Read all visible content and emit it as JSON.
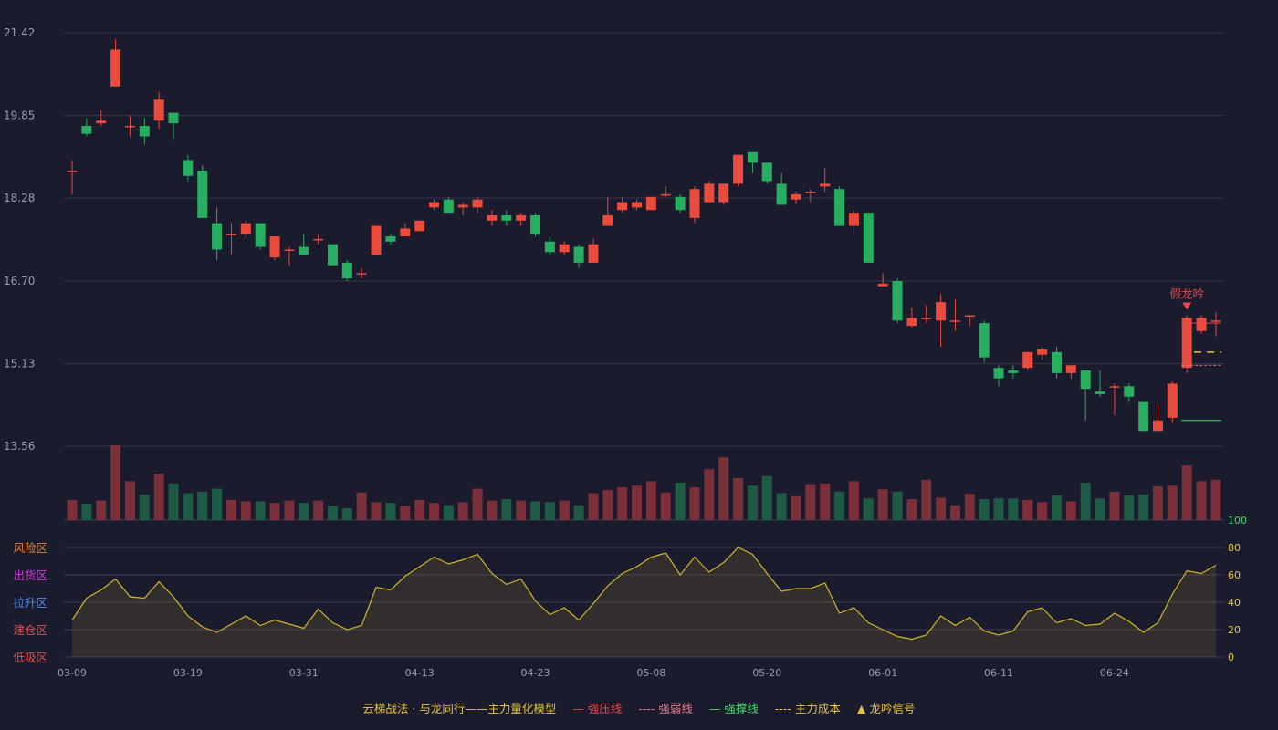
{
  "chart_data": {
    "type": "candlestick",
    "price_ticks": [
      "21.42",
      "19.85",
      "18.28",
      "16.70",
      "15.13",
      "13.56"
    ],
    "price_range": [
      13.56,
      21.42
    ],
    "x_ticks": [
      {
        "index": 0,
        "label": "03-09"
      },
      {
        "index": 8,
        "label": "03-19"
      },
      {
        "index": 16,
        "label": "03-31"
      },
      {
        "index": 24,
        "label": "04-13"
      },
      {
        "index": 32,
        "label": "04-23"
      },
      {
        "index": 40,
        "label": "05-08"
      },
      {
        "index": 48,
        "label": "05-20"
      },
      {
        "index": 56,
        "label": "06-01"
      },
      {
        "index": 64,
        "label": "06-11"
      },
      {
        "index": 72,
        "label": "06-24"
      }
    ],
    "candles": [
      [
        18.8,
        18.8,
        19.0,
        18.35
      ],
      [
        19.65,
        19.5,
        19.8,
        19.45
      ],
      [
        19.7,
        19.75,
        19.95,
        19.65
      ],
      [
        20.4,
        21.1,
        21.3,
        20.4
      ],
      [
        19.65,
        19.65,
        19.85,
        19.45
      ],
      [
        19.65,
        19.45,
        19.8,
        19.3
      ],
      [
        19.75,
        20.15,
        20.3,
        19.6
      ],
      [
        19.9,
        19.7,
        19.9,
        19.4
      ],
      [
        19.0,
        18.7,
        19.1,
        18.6
      ],
      [
        18.8,
        17.9,
        18.9,
        17.9
      ],
      [
        17.8,
        17.3,
        18.1,
        17.1
      ],
      [
        17.6,
        17.6,
        17.8,
        17.2
      ],
      [
        17.6,
        17.8,
        17.85,
        17.5
      ],
      [
        17.8,
        17.35,
        17.8,
        17.3
      ],
      [
        17.15,
        17.55,
        17.55,
        17.1
      ],
      [
        17.3,
        17.3,
        17.35,
        17.0
      ],
      [
        17.35,
        17.2,
        17.6,
        17.2
      ],
      [
        17.5,
        17.5,
        17.6,
        17.4
      ],
      [
        17.4,
        17.0,
        17.4,
        17.0
      ],
      [
        17.05,
        16.75,
        17.1,
        16.7
      ],
      [
        16.85,
        16.85,
        16.95,
        16.75
      ],
      [
        17.2,
        17.75,
        17.75,
        17.2
      ],
      [
        17.55,
        17.45,
        17.6,
        17.4
      ],
      [
        17.55,
        17.7,
        17.8,
        17.55
      ],
      [
        17.65,
        17.85,
        17.85,
        17.65
      ],
      [
        18.1,
        18.2,
        18.25,
        18.05
      ],
      [
        18.25,
        18.0,
        18.3,
        18.0
      ],
      [
        18.1,
        18.15,
        18.2,
        17.95
      ],
      [
        18.1,
        18.25,
        18.3,
        18.0
      ],
      [
        17.85,
        17.95,
        18.05,
        17.75
      ],
      [
        17.95,
        17.85,
        18.05,
        17.75
      ],
      [
        17.85,
        17.95,
        18.0,
        17.75
      ],
      [
        17.95,
        17.6,
        18.0,
        17.55
      ],
      [
        17.45,
        17.25,
        17.55,
        17.2
      ],
      [
        17.25,
        17.4,
        17.45,
        17.2
      ],
      [
        17.35,
        17.05,
        17.4,
        16.95
      ],
      [
        17.05,
        17.4,
        17.5,
        17.05
      ],
      [
        17.75,
        17.95,
        18.3,
        17.75
      ],
      [
        18.05,
        18.2,
        18.3,
        18.0
      ],
      [
        18.1,
        18.2,
        18.25,
        18.05
      ],
      [
        18.05,
        18.3,
        18.3,
        18.05
      ],
      [
        18.35,
        18.35,
        18.5,
        18.3
      ],
      [
        18.3,
        18.05,
        18.35,
        18.0
      ],
      [
        17.9,
        18.45,
        18.5,
        17.8
      ],
      [
        18.2,
        18.55,
        18.6,
        18.2
      ],
      [
        18.2,
        18.55,
        18.55,
        18.15
      ],
      [
        18.55,
        19.1,
        19.1,
        18.5
      ],
      [
        19.15,
        18.95,
        19.15,
        18.75
      ],
      [
        18.95,
        18.6,
        18.95,
        18.55
      ],
      [
        18.55,
        18.15,
        18.75,
        18.15
      ],
      [
        18.25,
        18.35,
        18.4,
        18.15
      ],
      [
        18.4,
        18.4,
        18.45,
        18.2
      ],
      [
        18.5,
        18.55,
        18.85,
        18.4
      ],
      [
        18.45,
        17.75,
        18.5,
        17.75
      ],
      [
        17.75,
        18.0,
        18.05,
        17.6
      ],
      [
        18.0,
        17.05,
        18.0,
        17.05
      ],
      [
        16.6,
        16.65,
        16.85,
        16.6
      ],
      [
        16.7,
        15.95,
        16.75,
        15.9
      ],
      [
        15.85,
        16.0,
        16.2,
        15.8
      ],
      [
        16.0,
        16.0,
        16.25,
        15.9
      ],
      [
        15.95,
        16.3,
        16.45,
        15.45
      ],
      [
        15.95,
        15.95,
        16.35,
        15.75
      ],
      [
        16.05,
        16.05,
        16.05,
        15.85
      ],
      [
        15.9,
        15.25,
        15.95,
        15.15
      ],
      [
        15.05,
        14.85,
        15.1,
        14.7
      ],
      [
        15.0,
        14.95,
        15.1,
        14.85
      ],
      [
        15.05,
        15.35,
        15.35,
        15.0
      ],
      [
        15.3,
        15.4,
        15.45,
        15.2
      ],
      [
        15.35,
        14.95,
        15.45,
        14.85
      ],
      [
        14.95,
        15.1,
        15.1,
        14.85
      ],
      [
        15.0,
        14.65,
        15.0,
        14.05
      ],
      [
        14.6,
        14.55,
        15.0,
        14.5
      ],
      [
        14.7,
        14.7,
        14.75,
        14.15
      ],
      [
        14.7,
        14.5,
        14.75,
        14.4
      ],
      [
        14.4,
        13.85,
        14.4,
        13.85
      ],
      [
        13.85,
        14.05,
        14.35,
        13.85
      ],
      [
        14.1,
        14.75,
        14.8,
        14.0
      ],
      [
        15.05,
        16.0,
        16.05,
        14.95
      ],
      [
        15.75,
        16.0,
        16.05,
        15.7
      ],
      [
        15.95,
        15.95,
        16.1,
        15.65
      ]
    ],
    "volume": [
      27,
      22,
      26,
      100,
      52,
      34,
      62,
      49,
      36,
      38,
      42,
      27,
      25,
      25,
      23,
      26,
      23,
      26,
      19,
      16,
      37,
      24,
      23,
      19,
      27,
      23,
      20,
      24,
      42,
      26,
      28,
      26,
      25,
      24,
      26,
      20,
      36,
      40,
      44,
      46,
      52,
      37,
      50,
      44,
      68,
      84,
      56,
      46,
      59,
      36,
      32,
      48,
      49,
      38,
      52,
      29,
      41,
      38,
      28,
      54,
      30,
      20,
      35,
      28,
      29,
      29,
      27,
      24,
      33,
      25,
      50,
      29,
      38,
      33,
      34,
      45,
      46,
      73,
      52,
      54
    ],
    "indicator": [
      27,
      43,
      49,
      57,
      44,
      43,
      55,
      44,
      30,
      22,
      18,
      24,
      30,
      23,
      27,
      24,
      21,
      35,
      25,
      20,
      23,
      51,
      49,
      59,
      66,
      73,
      68,
      71,
      75,
      61,
      53,
      57,
      41,
      31,
      36,
      27,
      39,
      52,
      61,
      66,
      73,
      76,
      60,
      73,
      62,
      69,
      80,
      75,
      61,
      48,
      50,
      50,
      54,
      32,
      36,
      25,
      20,
      15,
      13,
      16,
      30,
      23,
      29,
      19,
      16,
      19,
      33,
      36,
      25,
      28,
      23,
      24,
      32,
      26,
      18,
      25,
      46,
      63,
      61,
      67
    ],
    "indicator_axis": [
      "100",
      "80",
      "60",
      "40",
      "20",
      "0"
    ],
    "zones": [
      {
        "label": "风险区",
        "color": "#e0842c"
      },
      {
        "label": "出货区",
        "color": "#d03ce0"
      },
      {
        "label": "拉升区",
        "color": "#4a8cf0"
      },
      {
        "label": "建仓区",
        "color": "#e05050"
      },
      {
        "label": "低吸区",
        "color": "#e05050"
      }
    ],
    "annotation": "假龙吟",
    "levels": {
      "strong_resistance": 15.9,
      "weak_line": 15.1,
      "strong_support": 14.05,
      "main_cost": 15.35
    }
  },
  "legend": {
    "title": "云梯战法 · 与龙同行——主力量化模型",
    "items": [
      {
        "symbol": "—",
        "label": "强压线",
        "color": "#e84848"
      },
      {
        "symbol": "----",
        "label": "强弱线",
        "color": "#e87a8a"
      },
      {
        "symbol": "—",
        "label": "强撑线",
        "color": "#3de06a"
      },
      {
        "symbol": "----",
        "label": "主力成本",
        "color": "#e8c23a"
      },
      {
        "symbol": "▲",
        "label": "龙吟信号",
        "color": "#e8c23a"
      }
    ]
  },
  "colors": {
    "up": "#e94b3c",
    "down": "#27ae60",
    "up_volume": "#7b2f38",
    "down_volume": "#1f5a45",
    "indicator": "#d4b429"
  }
}
